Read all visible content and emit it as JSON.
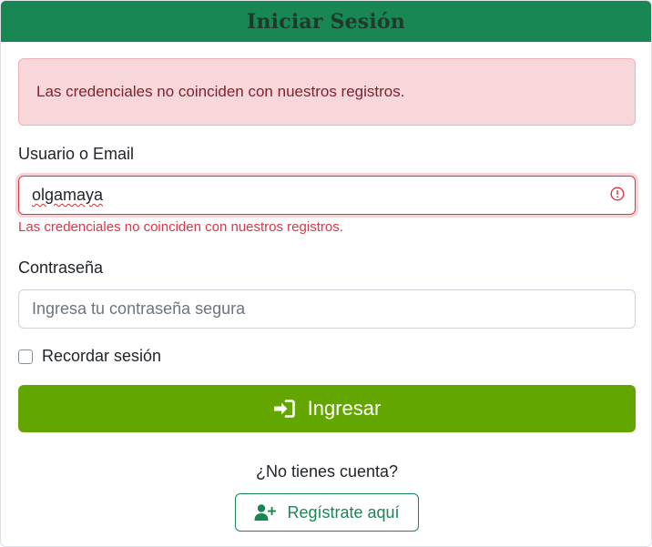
{
  "header": {
    "title": "Iniciar Sesión"
  },
  "alert": {
    "message": "Las credenciales no coinciden con nuestros registros."
  },
  "username": {
    "label": "Usuario o Email",
    "value": "olgamaya",
    "error": "Las credenciales no coinciden con nuestros registros."
  },
  "password": {
    "label": "Contraseña",
    "placeholder": "Ingresa tu contraseña segura"
  },
  "remember": {
    "label": "Recordar sesión",
    "checked": false
  },
  "login_button": {
    "label": "Ingresar",
    "icon": "sign-in-icon"
  },
  "register": {
    "question": "¿No tienes cuenta?",
    "button_label": "Regístrate aquí",
    "icon": "user-plus-icon"
  },
  "colors": {
    "header_bg": "#198754",
    "primary_button": "#63a600",
    "error": "#dc3545",
    "alert_bg": "#f8d7da",
    "alert_text": "#842029",
    "outline": "#198754"
  }
}
